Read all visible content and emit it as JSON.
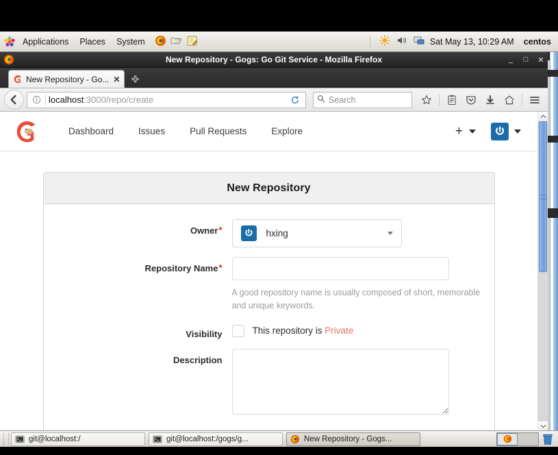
{
  "desktop": {
    "panel": {
      "menus": [
        "Applications",
        "Places",
        "System"
      ],
      "launchers": [
        "firefox-icon",
        "file-manager-icon",
        "text-editor-icon"
      ],
      "tray": [
        "brightness-icon",
        "volume-icon",
        "display-icon"
      ],
      "clock": "Sat May 13, 10:29 AM",
      "user": "centos"
    },
    "taskbar": {
      "tasks": [
        {
          "label": "git@localhost:/",
          "icon": "terminal-icon",
          "active": false
        },
        {
          "label": "git@localhost:/gogs/g...",
          "icon": "terminal-icon",
          "active": false
        },
        {
          "label": "New Repository - Gogs...",
          "icon": "firefox-icon",
          "active": true
        }
      ],
      "workspaces": [
        "workspace-1",
        "workspace-2"
      ],
      "trash": "trash-icon"
    }
  },
  "browser": {
    "window_title": "New Repository - Gogs: Go Git Service - Mozilla Firefox",
    "window_buttons": {
      "minimize": "_",
      "maximize": "□",
      "close": "✕"
    },
    "tab": {
      "title": "New Repository - Go...",
      "close": "✕",
      "favicon": "gogs-icon"
    },
    "new_tab_label": "+",
    "toolbar": {
      "back": "back-arrow-icon",
      "identity": "info-icon",
      "url_host": "localhost",
      "url_path": ":3000/repo/create",
      "reload": "reload-icon",
      "search_placeholder": "Search",
      "icons": [
        "bookmark-star-icon",
        "library-icon",
        "pocket-icon",
        "downloads-icon",
        "home-icon",
        "menu-icon"
      ]
    }
  },
  "gogs": {
    "logo": "gogs-logo",
    "nav_links": [
      "Dashboard",
      "Issues",
      "Pull Requests",
      "Explore"
    ],
    "plus_button": "+",
    "user_avatar": "user-avatar",
    "panel": {
      "title": "New Repository",
      "fields": {
        "owner": {
          "label": "Owner",
          "required": "*",
          "value": "hxing"
        },
        "repo_name": {
          "label": "Repository Name",
          "required": "*",
          "value": "",
          "help": "A good repository name is usually composed of short, memorable and unique keywords."
        },
        "visibility": {
          "label": "Visibility",
          "checkbox_checked": false,
          "text": "This repository is ",
          "private_word": "Private"
        },
        "description": {
          "label": "Description",
          "value": ""
        }
      }
    }
  },
  "colors": {
    "gogs_blue": "#1b6ca8",
    "required_red": "#db2828",
    "private_red": "#e8736a",
    "panel_header_bg": "#f0f0f0"
  }
}
